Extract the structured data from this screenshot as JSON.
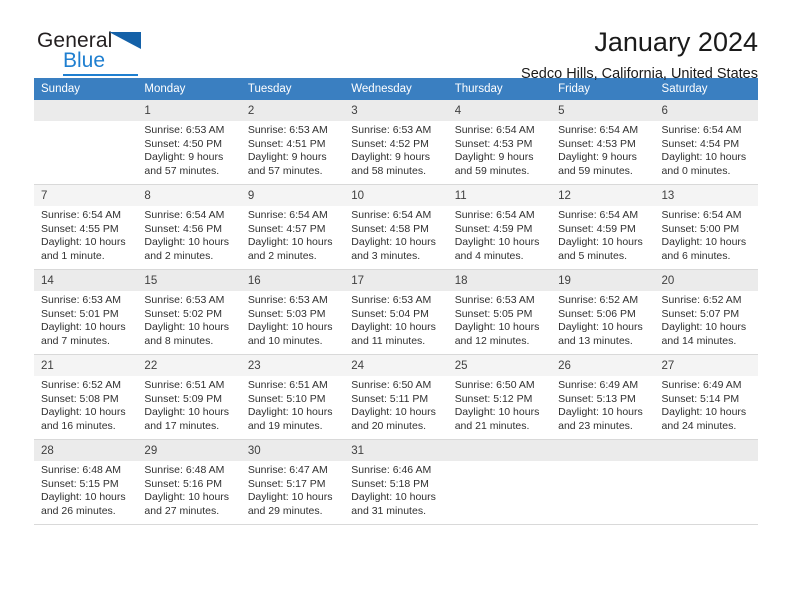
{
  "brand": {
    "word_one": "General",
    "word_two": "Blue",
    "flag_icon": "triangle-flag-icon",
    "accent_color": "#1f7fd0",
    "flag_color": "#1461a8"
  },
  "header": {
    "title": "January 2024",
    "subtitle": "Sedco Hills, California, United States"
  },
  "calendar": {
    "header_bg": "#3a7fc1",
    "weekday_headers": [
      "Sunday",
      "Monday",
      "Tuesday",
      "Wednesday",
      "Thursday",
      "Friday",
      "Saturday"
    ],
    "weeks": [
      [
        {
          "day": "",
          "sunrise": "",
          "sunset": "",
          "daylight_line1": "",
          "daylight_line2": ""
        },
        {
          "day": "1",
          "sunrise": "Sunrise: 6:53 AM",
          "sunset": "Sunset: 4:50 PM",
          "daylight_line1": "Daylight: 9 hours",
          "daylight_line2": "and 57 minutes."
        },
        {
          "day": "2",
          "sunrise": "Sunrise: 6:53 AM",
          "sunset": "Sunset: 4:51 PM",
          "daylight_line1": "Daylight: 9 hours",
          "daylight_line2": "and 57 minutes."
        },
        {
          "day": "3",
          "sunrise": "Sunrise: 6:53 AM",
          "sunset": "Sunset: 4:52 PM",
          "daylight_line1": "Daylight: 9 hours",
          "daylight_line2": "and 58 minutes."
        },
        {
          "day": "4",
          "sunrise": "Sunrise: 6:54 AM",
          "sunset": "Sunset: 4:53 PM",
          "daylight_line1": "Daylight: 9 hours",
          "daylight_line2": "and 59 minutes."
        },
        {
          "day": "5",
          "sunrise": "Sunrise: 6:54 AM",
          "sunset": "Sunset: 4:53 PM",
          "daylight_line1": "Daylight: 9 hours",
          "daylight_line2": "and 59 minutes."
        },
        {
          "day": "6",
          "sunrise": "Sunrise: 6:54 AM",
          "sunset": "Sunset: 4:54 PM",
          "daylight_line1": "Daylight: 10 hours",
          "daylight_line2": "and 0 minutes."
        }
      ],
      [
        {
          "day": "7",
          "sunrise": "Sunrise: 6:54 AM",
          "sunset": "Sunset: 4:55 PM",
          "daylight_line1": "Daylight: 10 hours",
          "daylight_line2": "and 1 minute."
        },
        {
          "day": "8",
          "sunrise": "Sunrise: 6:54 AM",
          "sunset": "Sunset: 4:56 PM",
          "daylight_line1": "Daylight: 10 hours",
          "daylight_line2": "and 2 minutes."
        },
        {
          "day": "9",
          "sunrise": "Sunrise: 6:54 AM",
          "sunset": "Sunset: 4:57 PM",
          "daylight_line1": "Daylight: 10 hours",
          "daylight_line2": "and 2 minutes."
        },
        {
          "day": "10",
          "sunrise": "Sunrise: 6:54 AM",
          "sunset": "Sunset: 4:58 PM",
          "daylight_line1": "Daylight: 10 hours",
          "daylight_line2": "and 3 minutes."
        },
        {
          "day": "11",
          "sunrise": "Sunrise: 6:54 AM",
          "sunset": "Sunset: 4:59 PM",
          "daylight_line1": "Daylight: 10 hours",
          "daylight_line2": "and 4 minutes."
        },
        {
          "day": "12",
          "sunrise": "Sunrise: 6:54 AM",
          "sunset": "Sunset: 4:59 PM",
          "daylight_line1": "Daylight: 10 hours",
          "daylight_line2": "and 5 minutes."
        },
        {
          "day": "13",
          "sunrise": "Sunrise: 6:54 AM",
          "sunset": "Sunset: 5:00 PM",
          "daylight_line1": "Daylight: 10 hours",
          "daylight_line2": "and 6 minutes."
        }
      ],
      [
        {
          "day": "14",
          "sunrise": "Sunrise: 6:53 AM",
          "sunset": "Sunset: 5:01 PM",
          "daylight_line1": "Daylight: 10 hours",
          "daylight_line2": "and 7 minutes."
        },
        {
          "day": "15",
          "sunrise": "Sunrise: 6:53 AM",
          "sunset": "Sunset: 5:02 PM",
          "daylight_line1": "Daylight: 10 hours",
          "daylight_line2": "and 8 minutes."
        },
        {
          "day": "16",
          "sunrise": "Sunrise: 6:53 AM",
          "sunset": "Sunset: 5:03 PM",
          "daylight_line1": "Daylight: 10 hours",
          "daylight_line2": "and 10 minutes."
        },
        {
          "day": "17",
          "sunrise": "Sunrise: 6:53 AM",
          "sunset": "Sunset: 5:04 PM",
          "daylight_line1": "Daylight: 10 hours",
          "daylight_line2": "and 11 minutes."
        },
        {
          "day": "18",
          "sunrise": "Sunrise: 6:53 AM",
          "sunset": "Sunset: 5:05 PM",
          "daylight_line1": "Daylight: 10 hours",
          "daylight_line2": "and 12 minutes."
        },
        {
          "day": "19",
          "sunrise": "Sunrise: 6:52 AM",
          "sunset": "Sunset: 5:06 PM",
          "daylight_line1": "Daylight: 10 hours",
          "daylight_line2": "and 13 minutes."
        },
        {
          "day": "20",
          "sunrise": "Sunrise: 6:52 AM",
          "sunset": "Sunset: 5:07 PM",
          "daylight_line1": "Daylight: 10 hours",
          "daylight_line2": "and 14 minutes."
        }
      ],
      [
        {
          "day": "21",
          "sunrise": "Sunrise: 6:52 AM",
          "sunset": "Sunset: 5:08 PM",
          "daylight_line1": "Daylight: 10 hours",
          "daylight_line2": "and 16 minutes."
        },
        {
          "day": "22",
          "sunrise": "Sunrise: 6:51 AM",
          "sunset": "Sunset: 5:09 PM",
          "daylight_line1": "Daylight: 10 hours",
          "daylight_line2": "and 17 minutes."
        },
        {
          "day": "23",
          "sunrise": "Sunrise: 6:51 AM",
          "sunset": "Sunset: 5:10 PM",
          "daylight_line1": "Daylight: 10 hours",
          "daylight_line2": "and 19 minutes."
        },
        {
          "day": "24",
          "sunrise": "Sunrise: 6:50 AM",
          "sunset": "Sunset: 5:11 PM",
          "daylight_line1": "Daylight: 10 hours",
          "daylight_line2": "and 20 minutes."
        },
        {
          "day": "25",
          "sunrise": "Sunrise: 6:50 AM",
          "sunset": "Sunset: 5:12 PM",
          "daylight_line1": "Daylight: 10 hours",
          "daylight_line2": "and 21 minutes."
        },
        {
          "day": "26",
          "sunrise": "Sunrise: 6:49 AM",
          "sunset": "Sunset: 5:13 PM",
          "daylight_line1": "Daylight: 10 hours",
          "daylight_line2": "and 23 minutes."
        },
        {
          "day": "27",
          "sunrise": "Sunrise: 6:49 AM",
          "sunset": "Sunset: 5:14 PM",
          "daylight_line1": "Daylight: 10 hours",
          "daylight_line2": "and 24 minutes."
        }
      ],
      [
        {
          "day": "28",
          "sunrise": "Sunrise: 6:48 AM",
          "sunset": "Sunset: 5:15 PM",
          "daylight_line1": "Daylight: 10 hours",
          "daylight_line2": "and 26 minutes."
        },
        {
          "day": "29",
          "sunrise": "Sunrise: 6:48 AM",
          "sunset": "Sunset: 5:16 PM",
          "daylight_line1": "Daylight: 10 hours",
          "daylight_line2": "and 27 minutes."
        },
        {
          "day": "30",
          "sunrise": "Sunrise: 6:47 AM",
          "sunset": "Sunset: 5:17 PM",
          "daylight_line1": "Daylight: 10 hours",
          "daylight_line2": "and 29 minutes."
        },
        {
          "day": "31",
          "sunrise": "Sunrise: 6:46 AM",
          "sunset": "Sunset: 5:18 PM",
          "daylight_line1": "Daylight: 10 hours",
          "daylight_line2": "and 31 minutes."
        },
        {
          "day": "",
          "sunrise": "",
          "sunset": "",
          "daylight_line1": "",
          "daylight_line2": ""
        },
        {
          "day": "",
          "sunrise": "",
          "sunset": "",
          "daylight_line1": "",
          "daylight_line2": ""
        },
        {
          "day": "",
          "sunrise": "",
          "sunset": "",
          "daylight_line1": "",
          "daylight_line2": ""
        }
      ]
    ]
  }
}
